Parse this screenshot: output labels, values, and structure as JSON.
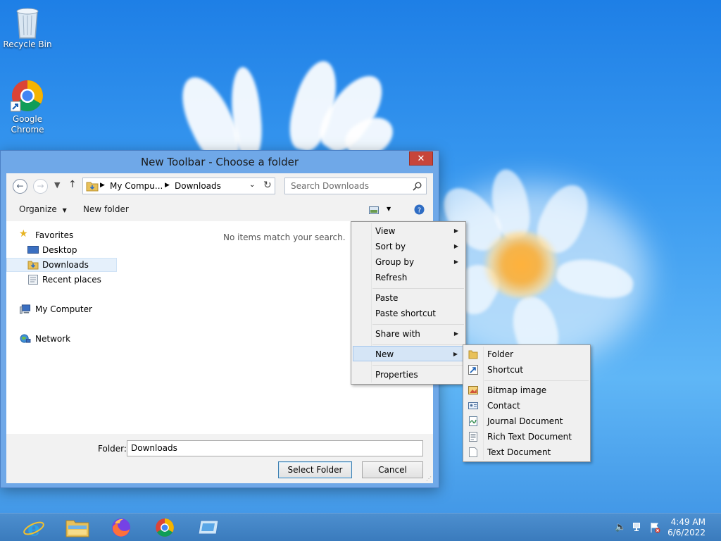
{
  "desktop": {
    "icons": [
      {
        "label": "Recycle Bin"
      },
      {
        "label_line1": "Google",
        "label_line2": "Chrome"
      }
    ]
  },
  "dialog": {
    "title": "New Toolbar - Choose a folder",
    "close_symbol": "✕",
    "breadcrumb": [
      "My Compu...",
      "Downloads"
    ],
    "search_placeholder": "Search Downloads",
    "toolbar": {
      "organize": "Organize",
      "new_folder": "New folder"
    },
    "nav": {
      "favorites": "Favorites",
      "desktop": "Desktop",
      "downloads": "Downloads",
      "recent": "Recent places",
      "computer": "My Computer",
      "network": "Network"
    },
    "empty_message": "No items match your search.",
    "folder_label": "Folder:",
    "folder_value": "Downloads",
    "select_button": "Select Folder",
    "cancel_button": "Cancel"
  },
  "context_menu": {
    "items": [
      "View",
      "Sort by",
      "Group by",
      "Refresh",
      "Paste",
      "Paste shortcut",
      "Share with",
      "New",
      "Properties"
    ]
  },
  "new_submenu": {
    "items": [
      "Folder",
      "Shortcut",
      "Bitmap image",
      "Contact",
      "Journal Document",
      "Rich Text Document",
      "Text Document"
    ]
  },
  "taskbar": {
    "time": "4:49 AM",
    "date": "6/6/2022"
  },
  "colors": {
    "accent": "#3a7bbd",
    "close": "#c7453a",
    "highlight": "#d5e5f6"
  }
}
